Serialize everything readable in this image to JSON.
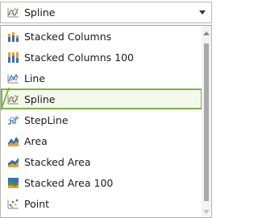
{
  "combo": {
    "selected_label": "Spline",
    "selected_icon": "spline-chart-icon"
  },
  "dropdown": {
    "items": [
      {
        "label": "Stacked Columns",
        "icon": "stacked-columns-icon",
        "selected": false
      },
      {
        "label": "Stacked Columns 100",
        "icon": "stacked-columns-100-icon",
        "selected": false
      },
      {
        "label": "Line",
        "icon": "line-chart-icon",
        "selected": false
      },
      {
        "label": "Spline",
        "icon": "spline-chart-icon",
        "selected": true
      },
      {
        "label": "StepLine",
        "icon": "stepline-chart-icon",
        "selected": false
      },
      {
        "label": "Area",
        "icon": "area-chart-icon",
        "selected": false
      },
      {
        "label": "Stacked Area",
        "icon": "stacked-area-icon",
        "selected": false
      },
      {
        "label": "Stacked Area 100",
        "icon": "stacked-area-100-icon",
        "selected": false
      },
      {
        "label": "Point",
        "icon": "point-chart-icon",
        "selected": false
      }
    ]
  },
  "colors": {
    "selection_border": "#7cb342",
    "selection_fill": "#f4f9ec",
    "icon_blue": "#3a6fb0",
    "icon_orange": "#e8a13a",
    "icon_green": "#5a8f3c"
  }
}
